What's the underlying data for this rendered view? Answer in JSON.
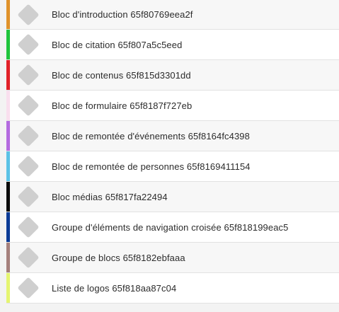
{
  "items": [
    {
      "label": "Bloc d'introduction 65f80769eea2f",
      "color": "#e0922a",
      "icon": "diamond-icon"
    },
    {
      "label": "Bloc de citation 65f807a5c5eed",
      "color": "#1fc43c",
      "icon": "diamond-icon"
    },
    {
      "label": "Bloc de contenus 65f815d3301dd",
      "color": "#e12128",
      "icon": "diamond-icon"
    },
    {
      "label": "Bloc de formulaire 65f8187f727eb",
      "color": "#f9dfee",
      "icon": "diamond-icon"
    },
    {
      "label": "Bloc de remontée d'événements 65f8164fc4398",
      "color": "#b46be0",
      "icon": "diamond-icon"
    },
    {
      "label": "Bloc de remontée de personnes 65f8169411154",
      "color": "#5bc2e6",
      "icon": "diamond-icon"
    },
    {
      "label": "Bloc médias 65f817fa22494",
      "color": "#0b0b0b",
      "icon": "diamond-icon"
    },
    {
      "label": "Groupe d'éléments de navigation croisée 65f818199eac5",
      "color": "#0b3b96",
      "icon": "diamond-icon"
    },
    {
      "label": "Groupe de blocs 65f8182ebfaaa",
      "color": "#a5807c",
      "icon": "diamond-icon"
    },
    {
      "label": "Liste de logos 65f818aa87c04",
      "color": "#e5f571",
      "icon": "diamond-icon"
    }
  ]
}
